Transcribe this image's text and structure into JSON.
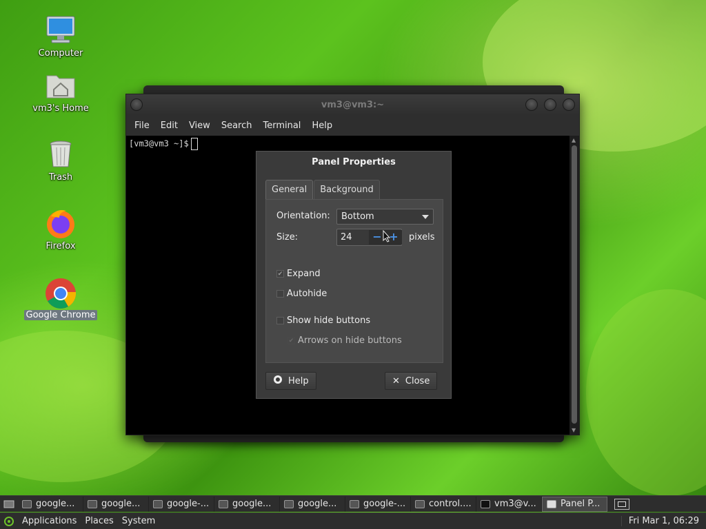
{
  "desktop": {
    "icons": [
      {
        "label": "Computer"
      },
      {
        "label": "vm3's Home"
      },
      {
        "label": "Trash"
      },
      {
        "label": "Firefox"
      },
      {
        "label": "Google Chrome"
      }
    ]
  },
  "terminal": {
    "title": "vm3@vm3:~",
    "menu": [
      "File",
      "Edit",
      "View",
      "Search",
      "Terminal",
      "Help"
    ],
    "prompt": "[vm3@vm3 ~]$"
  },
  "dialog": {
    "title": "Panel Properties",
    "tabs": [
      "General",
      "Background"
    ],
    "active_tab": "General",
    "orientation_label": "Orientation:",
    "orientation_value": "Bottom",
    "size_label": "Size:",
    "size_value": "24",
    "size_unit": "pixels",
    "expand_label": "Expand",
    "expand_checked": true,
    "autohide_label": "Autohide",
    "autohide_checked": false,
    "show_hide_label": "Show hide buttons",
    "show_hide_checked": false,
    "arrows_label": "Arrows on hide buttons",
    "arrows_checked": true,
    "help_label": "Help",
    "close_label": "Close"
  },
  "taskbar": {
    "tasks": [
      {
        "label": "google..."
      },
      {
        "label": "google..."
      },
      {
        "label": "google-..."
      },
      {
        "label": "google..."
      },
      {
        "label": "google..."
      },
      {
        "label": "google-..."
      },
      {
        "label": "control...."
      },
      {
        "label": "vm3@v..."
      },
      {
        "label": "Panel P..."
      }
    ],
    "active_task": "Panel P..."
  },
  "bottom_panel": {
    "menus": [
      "Applications",
      "Places",
      "System"
    ],
    "clock": "Fri Mar 1, 06:29"
  }
}
